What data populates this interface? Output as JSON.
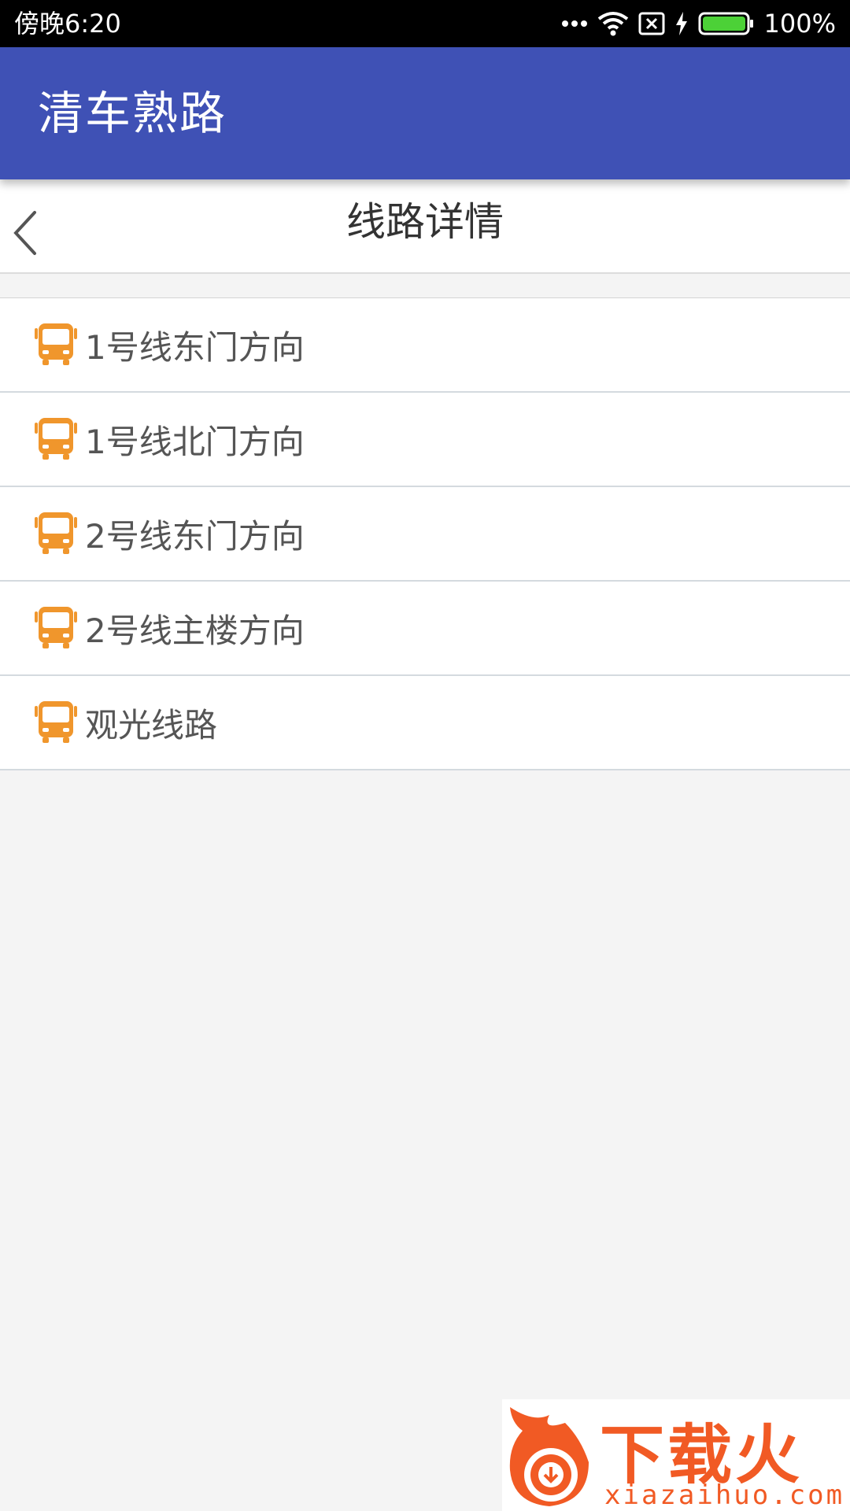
{
  "status_bar": {
    "time": "傍晚6:20",
    "battery": "100%",
    "icons": [
      "more-dots-icon",
      "wifi-icon",
      "sim-off-icon",
      "charging-icon",
      "battery-icon"
    ]
  },
  "app_bar": {
    "title": "清车熟路",
    "color": "#3f51b5"
  },
  "sub_header": {
    "title": "线路详情",
    "back_icon": "chevron-left-icon"
  },
  "routes": [
    {
      "label": "1号线东门方向",
      "icon": "bus-icon"
    },
    {
      "label": "1号线北门方向",
      "icon": "bus-icon"
    },
    {
      "label": "2号线东门方向",
      "icon": "bus-icon"
    },
    {
      "label": "2号线主楼方向",
      "icon": "bus-icon"
    },
    {
      "label": "观光线路",
      "icon": "bus-icon"
    }
  ],
  "colors": {
    "accent_icon": "#f0962c",
    "background": "#f4f4f4"
  },
  "watermark": {
    "brand": "下载火",
    "url": "xiazaihuo.com"
  }
}
